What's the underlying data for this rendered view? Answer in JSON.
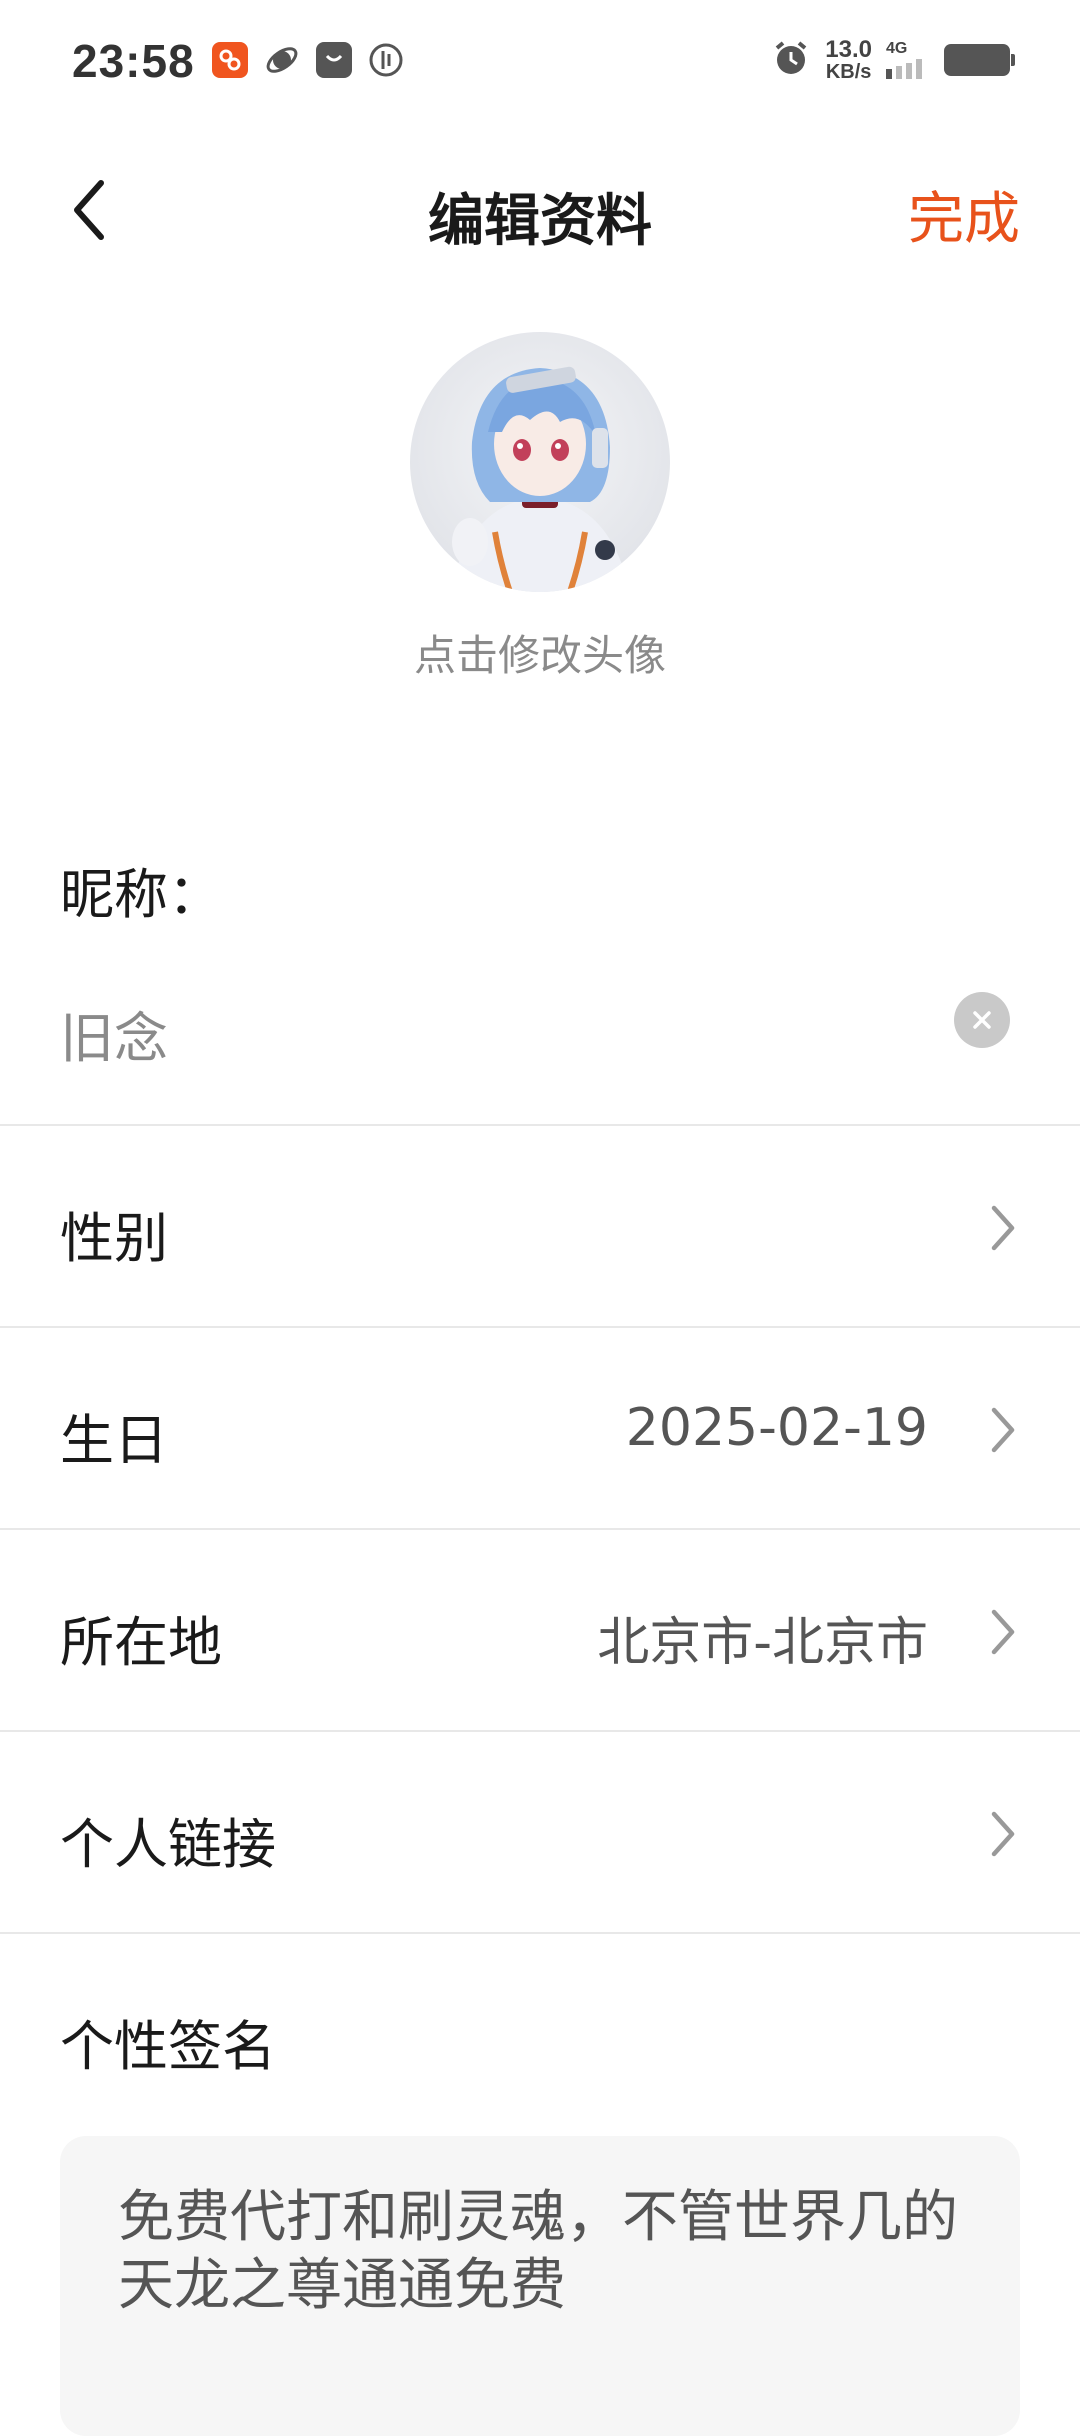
{
  "status_bar": {
    "time": "23:58",
    "net_speed_value": "13.0",
    "net_speed_unit": "KB/s",
    "network_type": "4G",
    "icons": [
      "taobao-icon",
      "planet-icon",
      "mail-bag-icon",
      "power-icon",
      "alarm-icon",
      "signal-icon",
      "battery-icon"
    ]
  },
  "header": {
    "title": "编辑资料",
    "done_label": "完成",
    "accent_color": "#e8521b"
  },
  "avatar": {
    "caption": "点击修改头像"
  },
  "nickname": {
    "label": "昵称：",
    "value": "旧念"
  },
  "rows": [
    {
      "label": "性别",
      "value": ""
    },
    {
      "label": "生日",
      "value": "2025-02-19"
    },
    {
      "label": "所在地",
      "value": "北京市-北京市"
    },
    {
      "label": "个人链接",
      "value": ""
    }
  ],
  "signature": {
    "label": "个性签名",
    "text": "免费代打和刷灵魂，不管世界几的天龙之尊通通免费"
  }
}
